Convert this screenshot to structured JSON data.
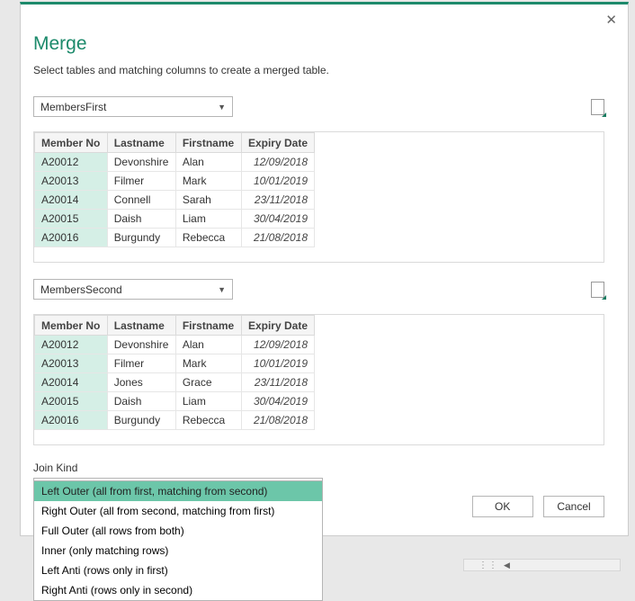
{
  "dialog": {
    "title": "Merge",
    "subtitle": "Select tables and matching columns to create a merged table."
  },
  "table1": {
    "source": "MembersFirst",
    "columns": [
      "Member No",
      "Lastname",
      "Firstname",
      "Expiry Date"
    ],
    "rows": [
      {
        "id": "A20012",
        "last": "Devonshire",
        "first": "Alan",
        "date": "12/09/2018"
      },
      {
        "id": "A20013",
        "last": "Filmer",
        "first": "Mark",
        "date": "10/01/2019"
      },
      {
        "id": "A20014",
        "last": "Connell",
        "first": "Sarah",
        "date": "23/11/2018"
      },
      {
        "id": "A20015",
        "last": "Daish",
        "first": "Liam",
        "date": "30/04/2019"
      },
      {
        "id": "A20016",
        "last": "Burgundy",
        "first": "Rebecca",
        "date": "21/08/2018"
      }
    ]
  },
  "table2": {
    "source": "MembersSecond",
    "columns": [
      "Member No",
      "Lastname",
      "Firstname",
      "Expiry Date"
    ],
    "rows": [
      {
        "id": "A20012",
        "last": "Devonshire",
        "first": "Alan",
        "date": "12/09/2018"
      },
      {
        "id": "A20013",
        "last": "Filmer",
        "first": "Mark",
        "date": "10/01/2019"
      },
      {
        "id": "A20014",
        "last": "Jones",
        "first": "Grace",
        "date": "23/11/2018"
      },
      {
        "id": "A20015",
        "last": "Daish",
        "first": "Liam",
        "date": "30/04/2019"
      },
      {
        "id": "A20016",
        "last": "Burgundy",
        "first": "Rebecca",
        "date": "21/08/2018"
      }
    ]
  },
  "joinkind": {
    "label": "Join Kind",
    "selected": "Left Outer (all from first, matching from second)",
    "options": [
      "Left Outer (all from first, matching from second)",
      "Right Outer (all from second, matching from first)",
      "Full Outer (all rows from both)",
      "Inner (only matching rows)",
      "Left Anti (rows only in first)",
      "Right Anti (rows only in second)"
    ]
  },
  "buttons": {
    "ok": "OK",
    "cancel": "Cancel"
  }
}
